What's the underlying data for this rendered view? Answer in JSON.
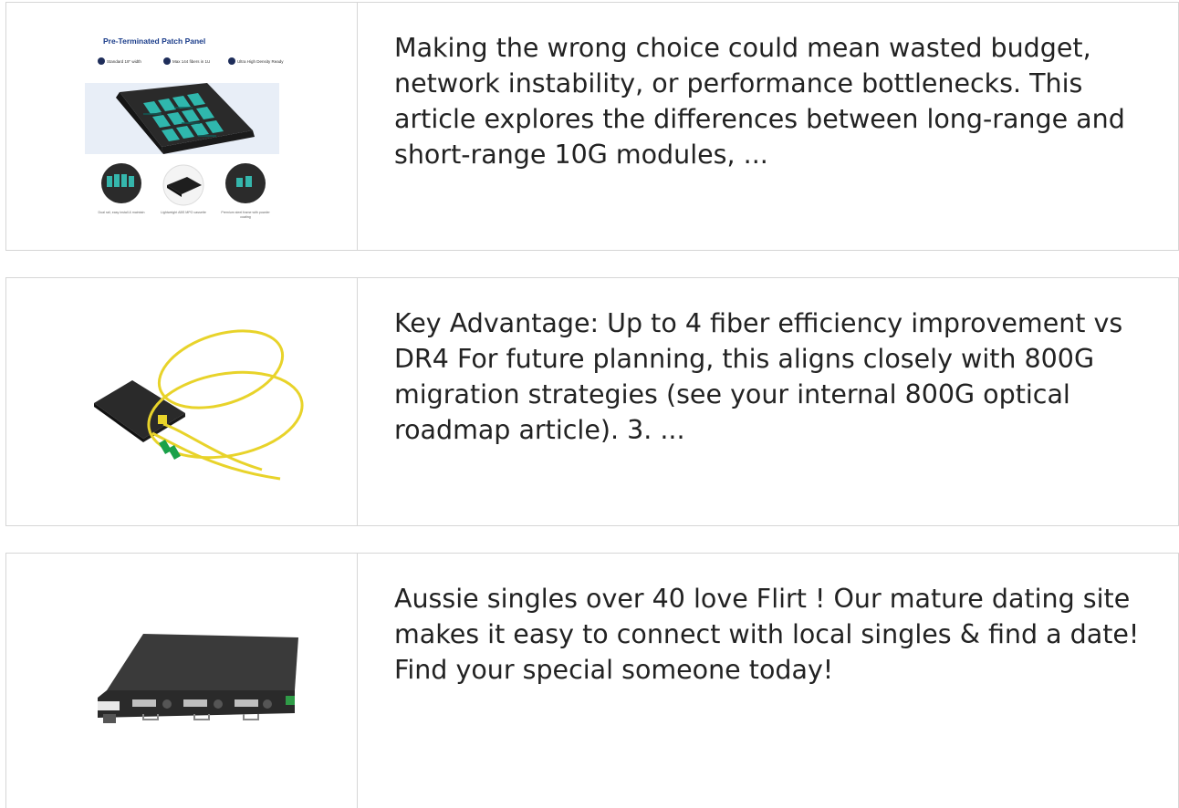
{
  "cards": [
    {
      "image": {
        "title": "Pre-Terminated Patch Panel",
        "features": [
          "Standard 19\" width",
          "Max 144 fibers in 1U",
          "Ultra High Density Ready"
        ],
        "captions": [
          "Dual rail, easy install & maintain",
          "Lightweight ABS MPO cassette",
          "Premium steel frame with powder coating"
        ]
      },
      "excerpt": "Making the wrong choice could mean wasted budget, network instability, or performance bottlenecks. This article explores the differences between long-range and short-range 10G modules, ..."
    },
    {
      "image": {},
      "excerpt": "Key Advantage: Up to 4 fiber efficiency improvement vs DR4 For future planning, this aligns closely with 800G migration strategies (see your internal 800G optical roadmap article). 3. ..."
    },
    {
      "image": {},
      "excerpt": "Aussie singles over 40 love Flirt ! Our mature dating site makes it easy to connect with local singles & find a date! Find your special someone today!"
    }
  ]
}
